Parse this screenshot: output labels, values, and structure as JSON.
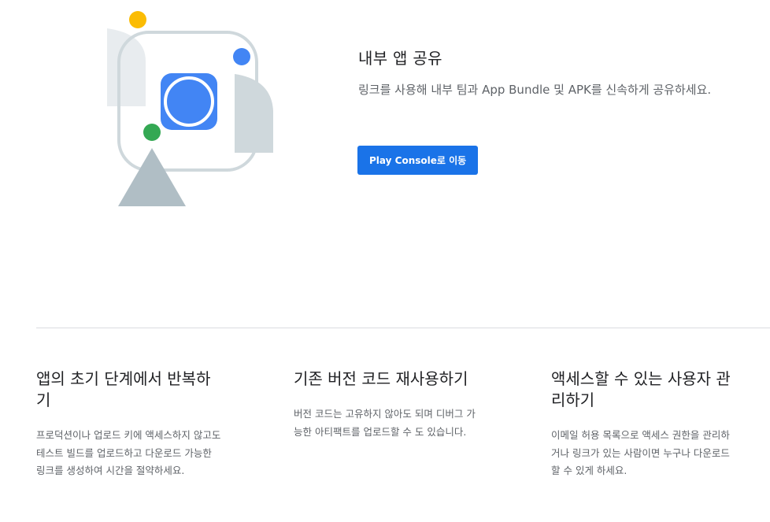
{
  "hero": {
    "title": "내부 앱 공유",
    "description": "링크를 사용해 내부 팀과 App Bundle 및 APK를 신속하게 공유하세요.",
    "button_label": "Play Console로 이동"
  },
  "features": [
    {
      "title": "앱의 초기 단계에서 반복하기",
      "description": "프로덕션이나 업로드 키에 액세스하지 않고도 테스트 빌드를 업로드하고 다운로드 가능한 링크를 생성하여 시간을 절약하세요."
    },
    {
      "title": "기존 버전 코드 재사용하기",
      "description": "버전 코드는 고유하지 않아도 되며 디버그 가능한 아티팩트를 업로드할 수 도 있습니다."
    },
    {
      "title": "액세스할 수 있는 사용자 관리하기",
      "description": "이메일 허용 목록으로 액세스 권한을 관리하거나 링크가 있는 사람이면 누구나 다운로드할 수 있게 하세요."
    }
  ],
  "colors": {
    "accent_blue": "#1a73e8",
    "app_icon_blue": "#4285f4",
    "dot_yellow": "#fbbc04",
    "dot_green": "#34a853",
    "dot_blue": "#4285f4",
    "shape_gray": "#b0bec5",
    "frame_gray": "#cfd8dc"
  }
}
